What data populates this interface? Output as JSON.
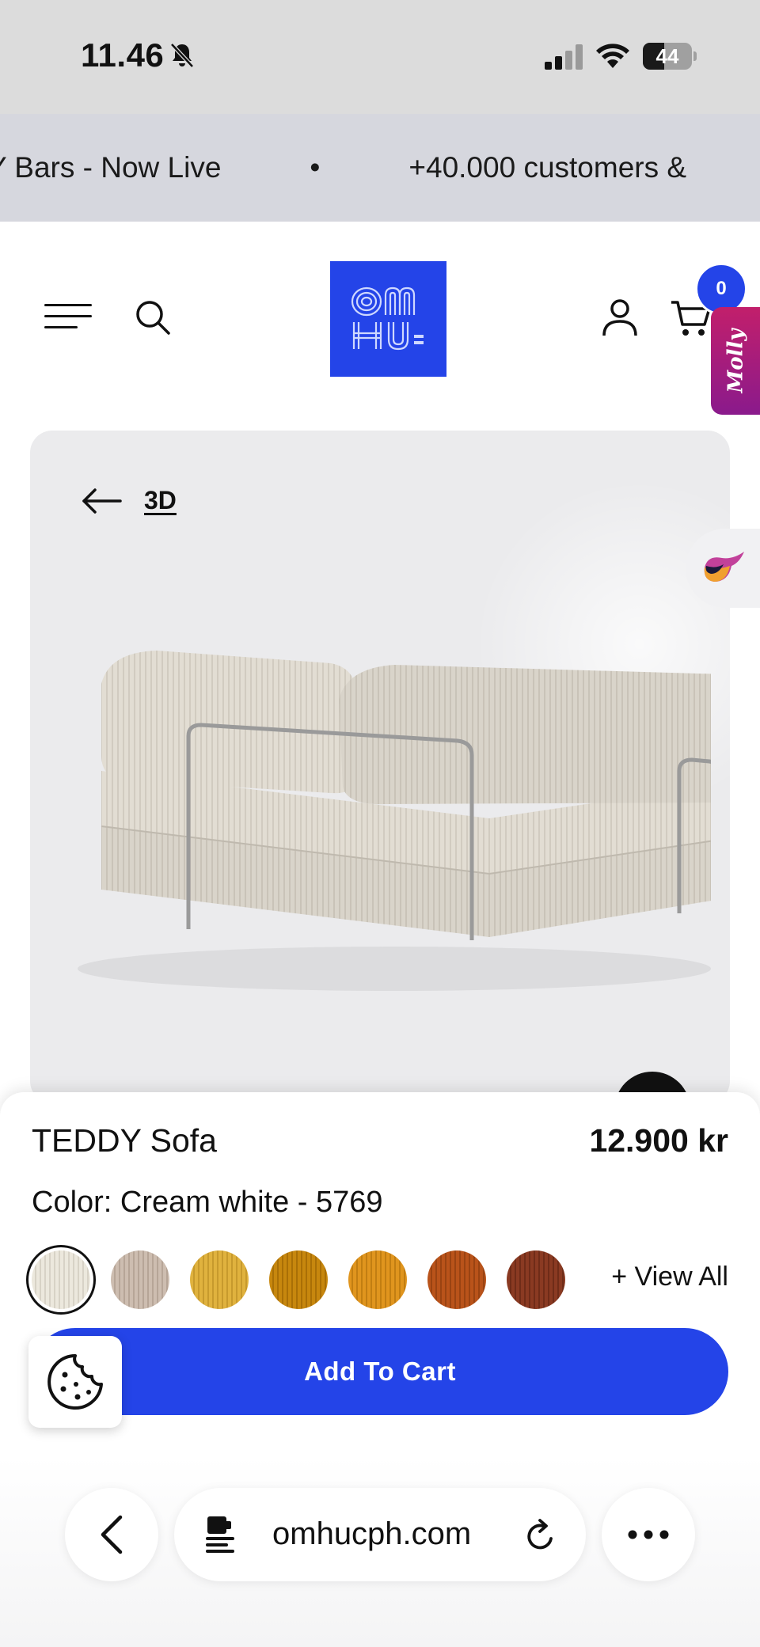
{
  "status_bar": {
    "time": "11.46",
    "battery_level": "44",
    "battery_fraction": 0.44
  },
  "announcement": {
    "items": [
      "Y Bars - Now Live",
      "•",
      "+40.000 customers &"
    ]
  },
  "header": {
    "logo_icon": "omhu-logo",
    "logo_text": "OM HU",
    "cart_count": "0",
    "molly_label": "Molly",
    "brand_color": "#2444e8"
  },
  "gallery": {
    "view_3d_label": "3D"
  },
  "product": {
    "title": "TEDDY Sofa",
    "price": "12.900 kr",
    "color_label": "Color: Cream white - 5769",
    "swatches": [
      {
        "color": "#ece8dd",
        "stripe": "#d7d2c6",
        "selected": true
      },
      {
        "color": "#cdbdb0",
        "stripe": "#b6a597",
        "selected": false
      },
      {
        "color": "#e0b23e",
        "stripe": "#c79a2d",
        "selected": false
      },
      {
        "color": "#c7870e",
        "stripe": "#a96f06",
        "selected": false
      },
      {
        "color": "#e0951e",
        "stripe": "#c27e12",
        "selected": false
      },
      {
        "color": "#b9531a",
        "stripe": "#9a4312",
        "selected": false
      },
      {
        "color": "#8a3a22",
        "stripe": "#6f2c18",
        "selected": false
      }
    ],
    "view_all_label": "+ View All",
    "add_to_cart_label": "Add To Cart"
  },
  "browser": {
    "url": "omhucph.com"
  }
}
